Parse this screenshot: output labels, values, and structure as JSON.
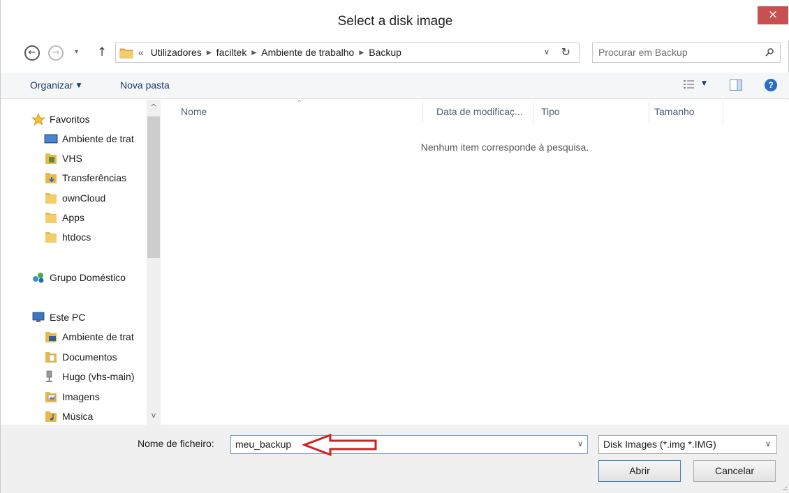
{
  "window": {
    "title": "Select a disk image",
    "close_label": "×"
  },
  "nav": {
    "back_glyph": "←",
    "forward_glyph": "→",
    "recent_glyph": "▾",
    "up_glyph": "↑",
    "breadcrumb_lead": "«",
    "breadcrumbs": [
      "Utilizadores",
      "faciltek",
      "Ambiente de trabalho",
      "Backup"
    ],
    "dropdown_glyph": "∨",
    "refresh_glyph": "↻",
    "search_placeholder": "Procurar em Backup"
  },
  "toolbar": {
    "organize_label": "Organizar",
    "organize_caret": "▼",
    "new_folder_label": "Nova pasta",
    "view_caret": "▼",
    "help_glyph": "?"
  },
  "sidebar": {
    "favorites_label": "Favoritos",
    "favorites": [
      {
        "label": "Ambiente de trat",
        "icon": "desktop-icon"
      },
      {
        "label": "VHS",
        "icon": "folder-icon"
      },
      {
        "label": "Transferências",
        "icon": "downloads-folder-icon"
      },
      {
        "label": "ownCloud",
        "icon": "folder-icon"
      },
      {
        "label": "Apps",
        "icon": "folder-icon"
      },
      {
        "label": "htdocs",
        "icon": "folder-icon"
      }
    ],
    "homegroup_label": "Grupo Doméstico",
    "thispc_label": "Este PC",
    "thispc_items": [
      {
        "label": "Ambiente de trat",
        "icon": "desktop-folder-icon"
      },
      {
        "label": "Documentos",
        "icon": "documents-folder-icon"
      },
      {
        "label": "Hugo (vhs-main)",
        "icon": "network-drive-icon"
      },
      {
        "label": "Imagens",
        "icon": "pictures-folder-icon"
      },
      {
        "label": "Música",
        "icon": "music-folder-icon"
      }
    ],
    "scroll_up_glyph": "^",
    "scroll_down_glyph": "v"
  },
  "filelist": {
    "columns": [
      "Nome",
      "Data de modificaç...",
      "Tipo",
      "Tamanho"
    ],
    "sort_glyph": "^",
    "empty_message": "Nenhum item corresponde à pesquisa."
  },
  "footer": {
    "filename_label": "Nome de ficheiro:",
    "filename_value": "meu_backup",
    "filename_dd_glyph": "∨",
    "filetype_value": "Disk Images (*.img *.IMG)",
    "filetype_dd_glyph": "∨",
    "open_label": "Abrir",
    "cancel_label": "Cancelar"
  },
  "colors": {
    "close_button": "#c75050",
    "annotation_arrow": "#d22020",
    "folder_yellow": "#e8b94a",
    "link_blue": "#1a3b69"
  }
}
